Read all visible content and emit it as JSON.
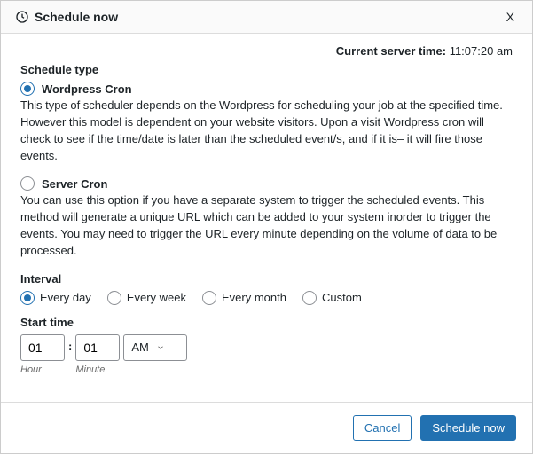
{
  "header": {
    "title": "Schedule now",
    "close": "X"
  },
  "server_time": {
    "label": "Current server time:",
    "value": "11:07:20 am"
  },
  "schedule_type": {
    "label": "Schedule type",
    "options": [
      {
        "name": "Wordpress Cron",
        "desc": "This type of scheduler depends on the Wordpress for scheduling your job at the specified time. However this model is dependent on your website visitors. Upon a visit Wordpress cron will check to see if the time/date is later than the scheduled event/s, and if it is– it will fire those events.",
        "selected": true
      },
      {
        "name": "Server Cron",
        "desc": "You can use this option if you have a separate system to trigger the scheduled events. This method will generate a unique URL which can be added to your system inorder to trigger the events. You may need to trigger the URL every minute depending on the volume of data to be processed.",
        "selected": false
      }
    ]
  },
  "interval": {
    "label": "Interval",
    "options": [
      "Every day",
      "Every week",
      "Every month",
      "Custom"
    ],
    "selected_index": 0
  },
  "start_time": {
    "label": "Start time",
    "hour": "01",
    "hour_hint": "Hour",
    "minute": "01",
    "minute_hint": "Minute",
    "period": "AM"
  },
  "footer": {
    "cancel": "Cancel",
    "submit": "Schedule now"
  }
}
